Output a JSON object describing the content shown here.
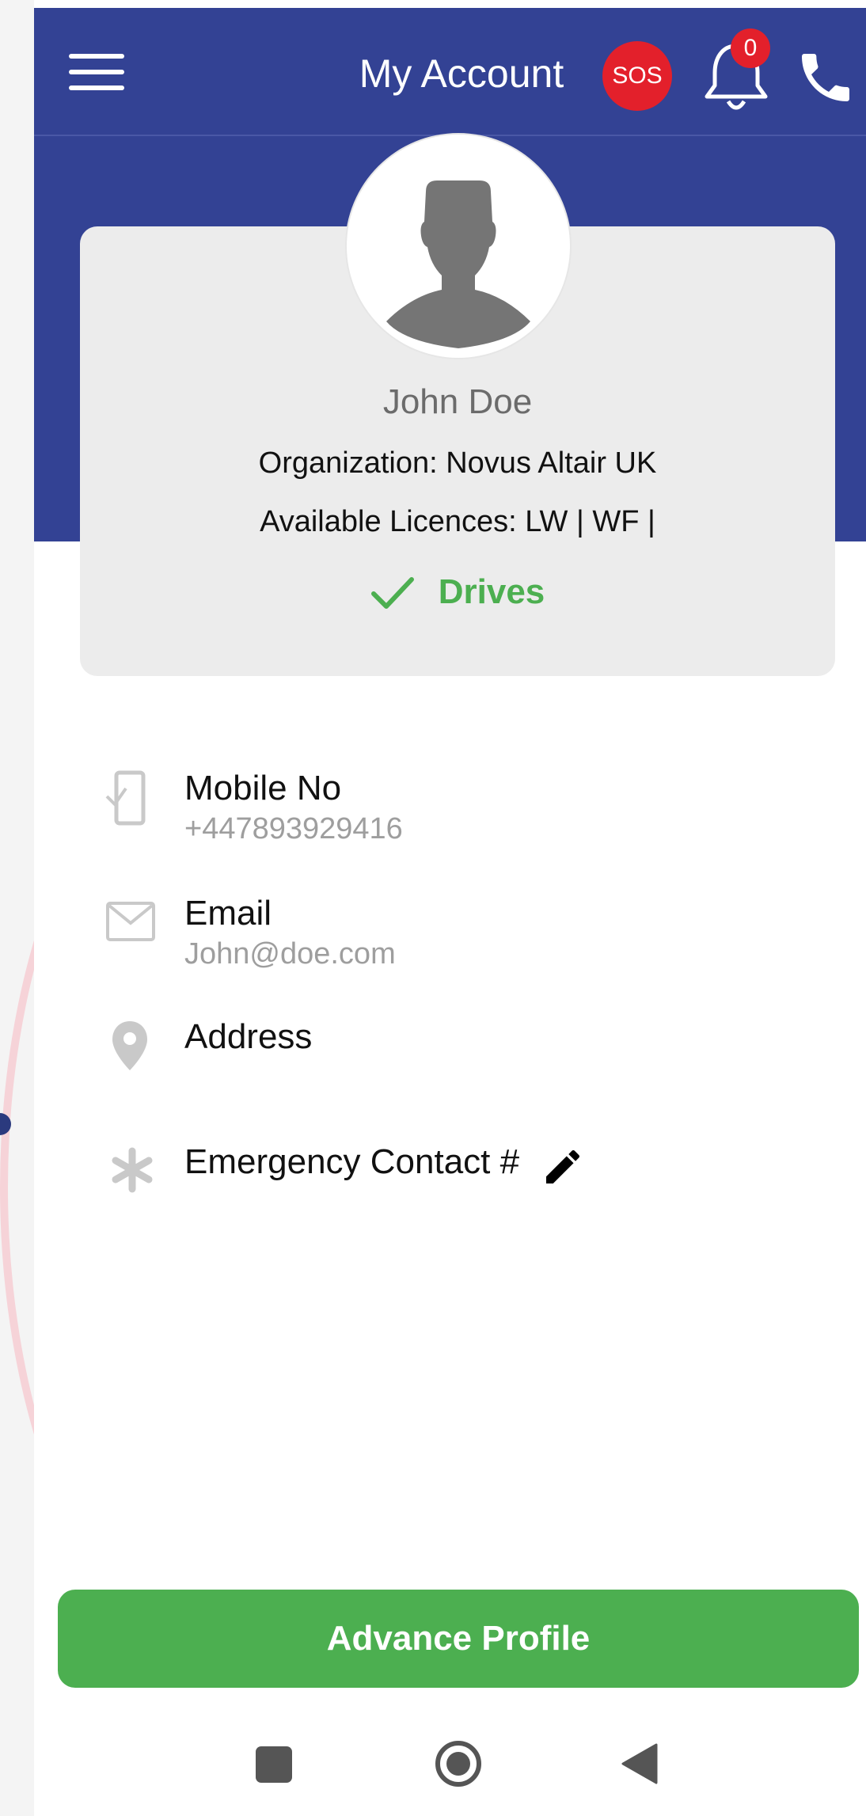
{
  "header": {
    "title": "My Account",
    "sos_label": "SOS",
    "notification_count": "0"
  },
  "profile": {
    "name": "John Doe",
    "organization": "Organization: Novus Altair UK",
    "licences": "Available Licences: LW | WF |",
    "drives_label": "Drives"
  },
  "details": {
    "mobile_label": "Mobile No",
    "mobile_value": "+447893929416",
    "email_label": "Email",
    "email_value": "John@doe.com",
    "address_label": "Address",
    "emergency_label": "Emergency Contact #"
  },
  "footer": {
    "advance_profile_label": "Advance Profile"
  },
  "colors": {
    "primary": "#334294",
    "sos": "#e3202b",
    "success": "#4caf50",
    "card": "#ececec"
  }
}
